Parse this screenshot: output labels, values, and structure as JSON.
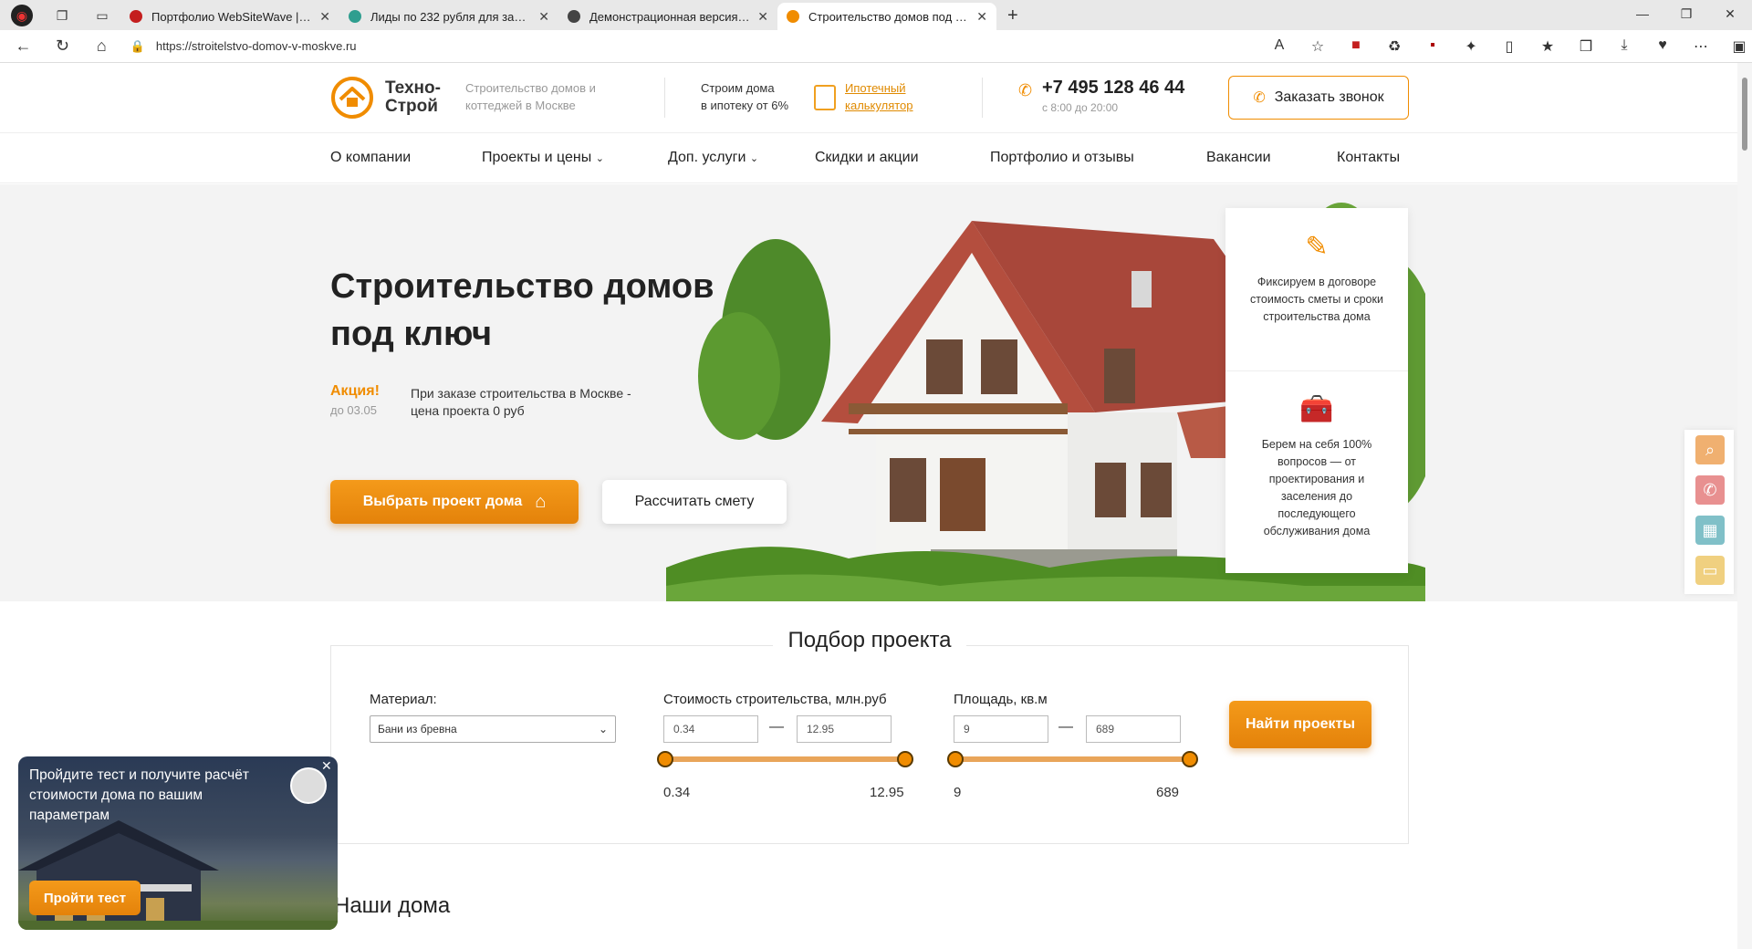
{
  "browser": {
    "tabs": [
      {
        "title": "Портфолио WebSiteWave | Креа",
        "fav_color": "#c41e1e",
        "active": false
      },
      {
        "title": "Лиды по 232 рубля для застрой",
        "fav_color": "#2f9e8f",
        "active": false
      },
      {
        "title": "Демонстрационная версия про",
        "fav_color": "#444444",
        "active": false
      },
      {
        "title": "Строительство домов под ключ",
        "fav_color": "#f08c00",
        "active": true
      }
    ],
    "url": "https://stroitelstvo-domov-v-moskve.ru"
  },
  "header": {
    "logo_line1": "Техно-",
    "logo_line2": "Строй",
    "tagline": "Строительство домов и коттеджей в Москве",
    "mortgage_line1": "Строим дома",
    "mortgage_line2": "в ипотеку от 6%",
    "calc_line1": "Ипотечный",
    "calc_line2": "калькулятор",
    "phone": "+7 495 128 46 44",
    "hours": "с 8:00 до 20:00",
    "call_button": "Заказать звонок"
  },
  "menu": [
    "О компании",
    "Проекты и цены",
    "Доп. услуги",
    "Скидки и акции",
    "Портфолио и отзывы",
    "Вакансии",
    "Контакты"
  ],
  "hero": {
    "title_line1": "Строительство домов",
    "title_line2": "под ключ",
    "promo_label": "Акция!",
    "promo_date": "до 03.05",
    "promo_text": "При заказе строительства в Москве - цена проекта 0 руб",
    "primary_button": "Выбрать проект дома",
    "secondary_button": "Рассчитать смету",
    "feature1": "Фиксируем в договоре стоимость сметы и сроки строительства дома",
    "feature2": "Берем на себя 100% вопросов — от проектирования и заселения до последующего обслуживания дома"
  },
  "selector": {
    "title": "Подбор проекта",
    "material_label": "Материал:",
    "material_value": "Бани из бревна",
    "cost_label": "Стоимость строительства, млн.руб",
    "cost_min": "0.34",
    "cost_max": "12.95",
    "area_label": "Площадь, кв.м",
    "area_min": "9",
    "area_max": "689",
    "dash": "—",
    "find_button": "Найти проекты"
  },
  "section_title": "Наши дома",
  "popup": {
    "text": "Пройдите тест и получите расчёт стоимости дома по вашим параметрам",
    "button": "Пройти тест"
  },
  "side_icons": [
    {
      "name": "search-icon",
      "color": "#f0b070"
    },
    {
      "name": "phone-icon",
      "color": "#e89090"
    },
    {
      "name": "grid-icon",
      "color": "#80c0c8"
    },
    {
      "name": "chat-icon",
      "color": "#f0d080"
    }
  ],
  "accent_color": "#f08c00"
}
